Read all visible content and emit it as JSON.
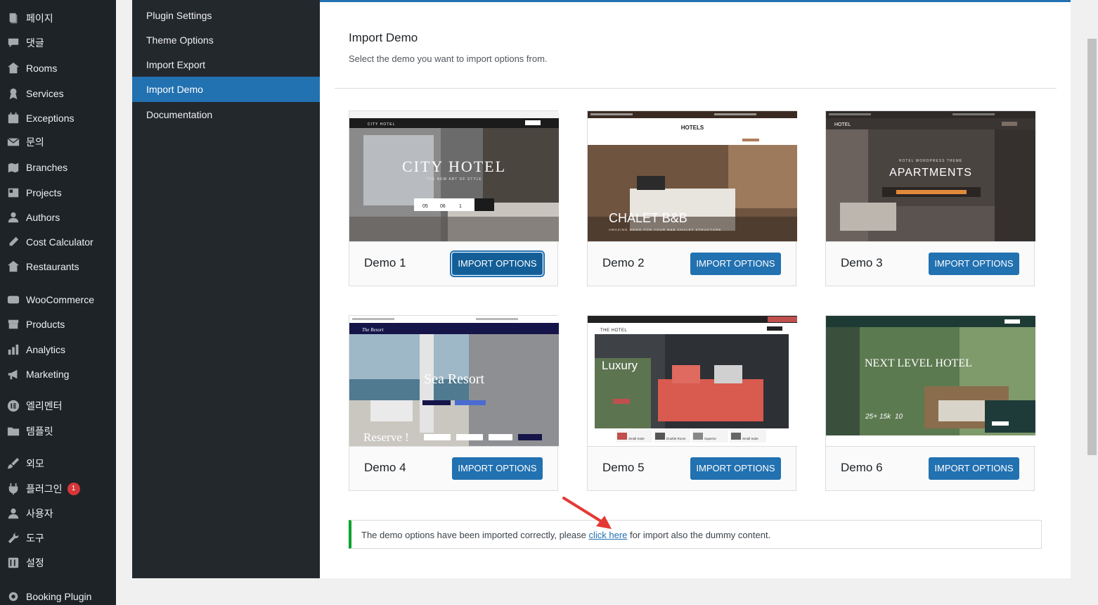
{
  "wp_menu": {
    "items": [
      {
        "label": "페이지",
        "icon": "page-icon"
      },
      {
        "label": "댓글",
        "icon": "comment-icon"
      },
      {
        "label": "Rooms",
        "icon": "building-icon"
      },
      {
        "label": "Services",
        "icon": "award-icon"
      },
      {
        "label": "Exceptions",
        "icon": "calendar-icon"
      },
      {
        "label": "문의",
        "icon": "email-icon"
      },
      {
        "label": "Branches",
        "icon": "location-icon"
      },
      {
        "label": "Projects",
        "icon": "portfolio-icon"
      },
      {
        "label": "Authors",
        "icon": "user-icon"
      },
      {
        "label": "Cost Calculator",
        "icon": "pencil-icon"
      },
      {
        "label": "Restaurants",
        "icon": "building-icon"
      },
      {
        "label": "WooCommerce",
        "icon": "woo-icon"
      },
      {
        "label": "Products",
        "icon": "archive-icon"
      },
      {
        "label": "Analytics",
        "icon": "chart-bar-icon"
      },
      {
        "label": "Marketing",
        "icon": "megaphone-icon"
      },
      {
        "label": "엘리멘터",
        "icon": "elementor-icon"
      },
      {
        "label": "템플릿",
        "icon": "folder-icon"
      },
      {
        "label": "외모",
        "icon": "brush-icon"
      },
      {
        "label": "플러그인",
        "icon": "plugin-icon",
        "badge": "1"
      },
      {
        "label": "사용자",
        "icon": "user-icon"
      },
      {
        "label": "도구",
        "icon": "wrench-icon"
      },
      {
        "label": "설정",
        "icon": "settings-icon"
      },
      {
        "label": "Booking Plugin",
        "icon": "gear-icon"
      }
    ]
  },
  "plugin_nav": {
    "items": [
      "Plugin Settings",
      "Theme Options",
      "Import Export",
      "Import Demo",
      "Documentation"
    ],
    "active": "Import Demo"
  },
  "content": {
    "title": "Import Demo",
    "description": "Select the demo you want to import options from."
  },
  "demos": [
    {
      "name": "Demo 1",
      "button": "IMPORT OPTIONS",
      "thumb_title": "CITY HOTEL",
      "thumb_logo": "CITY HOTEL",
      "thumb_subtitle": "THE NEW ART OF STYLE",
      "thumb_fields": [
        "05",
        "06",
        "1"
      ]
    },
    {
      "name": "Demo 2",
      "button": "IMPORT OPTIONS",
      "thumb_title": "CHALET B&B",
      "thumb_logo": "HOTELS",
      "thumb_subtitle": "AMAZING DEMO FOR YOUR B&B CHALET STRUCTURE"
    },
    {
      "name": "Demo 3",
      "button": "IMPORT OPTIONS",
      "thumb_title": "APARTMENTS",
      "thumb_logo": "HOTEL",
      "thumb_subtitle": "HOTEL WORDPRESS THEME"
    },
    {
      "name": "Demo 4",
      "button": "IMPORT OPTIONS",
      "thumb_title": "Sea Resort",
      "thumb_logo": "The Resort",
      "thumb_subtitle": "Reserve !"
    },
    {
      "name": "Demo 5",
      "button": "IMPORT OPTIONS",
      "thumb_title": "Luxury",
      "thumb_logo": "THE HOTEL",
      "thumb_rooms": [
        "Small Suite",
        "Double Room",
        "Superior",
        "Small Suite"
      ]
    },
    {
      "name": "Demo 6",
      "button": "IMPORT OPTIONS",
      "thumb_title": "NEXT LEVEL HOTEL",
      "thumb_stats": [
        "25+",
        "15k",
        "10"
      ]
    }
  ],
  "notice": {
    "before": "The demo options have been imported correctly, please ",
    "link": "click here",
    "after": " for import also the dummy content."
  }
}
